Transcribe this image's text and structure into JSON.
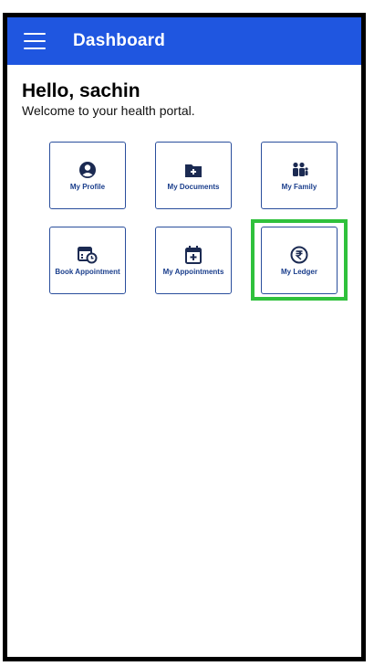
{
  "app_bar": {
    "title": "Dashboard",
    "menu_icon": "hamburger-menu-icon"
  },
  "greeting": {
    "title": "Hello, sachin",
    "subtitle": "Welcome to your health portal."
  },
  "tiles": [
    {
      "label": "My Profile",
      "icon": "account-circle-icon"
    },
    {
      "label": "My Documents",
      "icon": "folder-plus-icon"
    },
    {
      "label": "My Family",
      "icon": "family-group-icon"
    },
    {
      "label": "Book Appointment",
      "icon": "calendar-clock-icon"
    },
    {
      "label": "My Appointments",
      "icon": "calendar-plus-icon"
    },
    {
      "label": "My Ledger",
      "icon": "rupee-circle-icon"
    }
  ],
  "colors": {
    "app_bar": "#1f56e0",
    "tile_border": "#2a4e9c",
    "tile_text": "#1a3e8c",
    "highlight": "#2fc13c"
  }
}
